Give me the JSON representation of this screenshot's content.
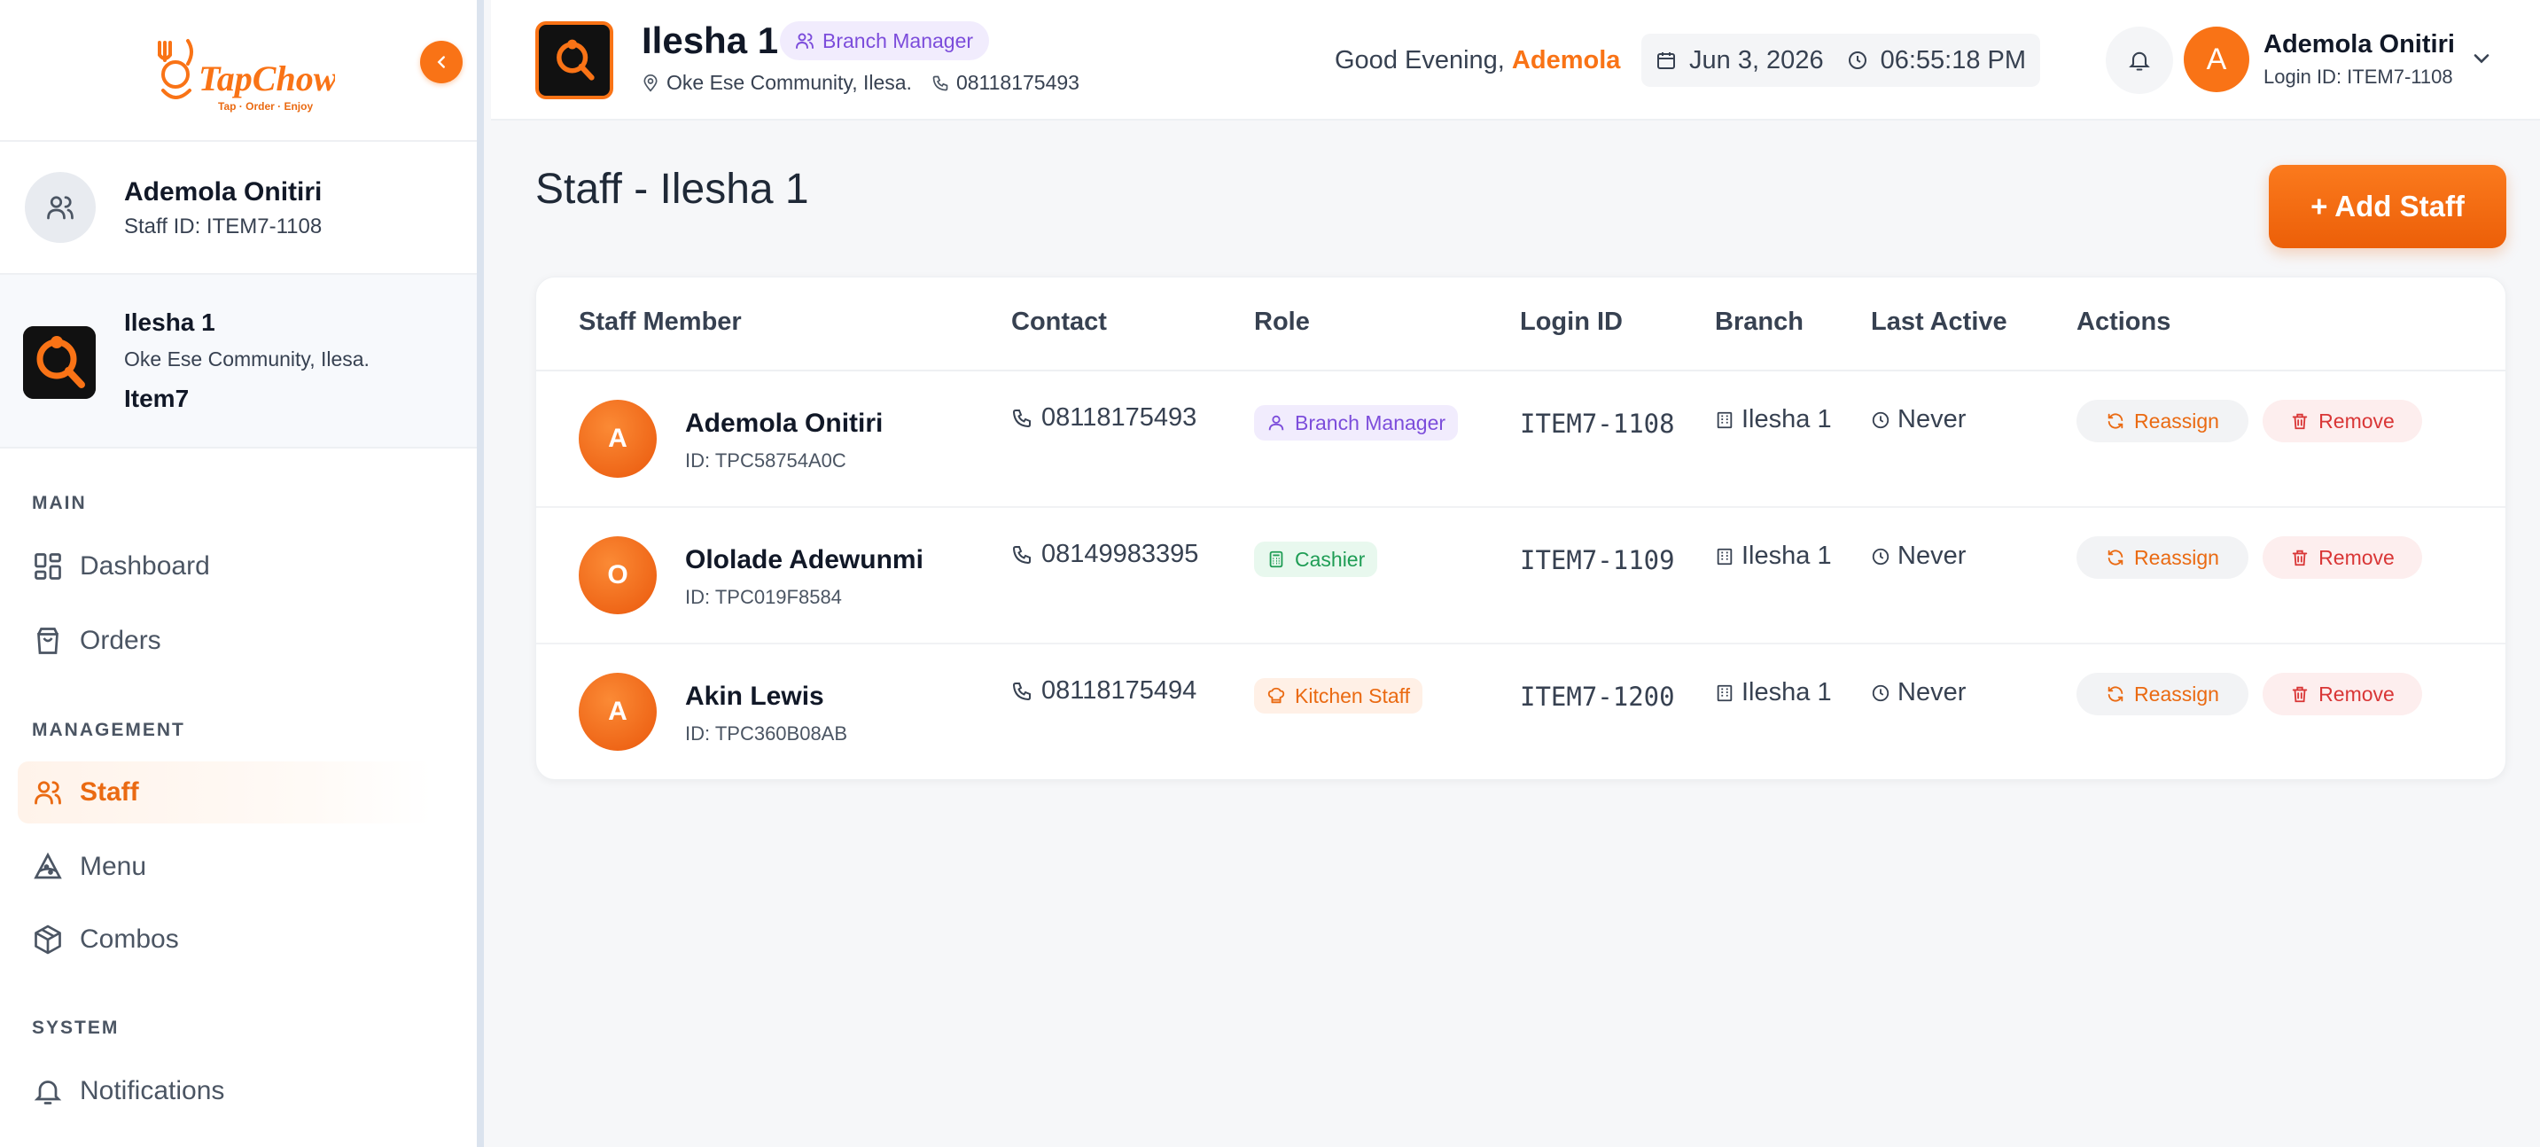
{
  "brand": {
    "logo_text": "TapChow",
    "tagline": "Tap · Order · Enjoy",
    "accent": "#f97316"
  },
  "sidebar": {
    "user": {
      "name": "Ademola Onitiri",
      "staff_id": "Staff ID: ITEM7-1108"
    },
    "branch": {
      "name": "Ilesha 1",
      "address": "Oke Ese Community, Ilesa.",
      "code": "Item7"
    },
    "sections": [
      {
        "title": "MAIN",
        "items": [
          {
            "label": "Dashboard",
            "icon": "grid-icon"
          },
          {
            "label": "Orders",
            "icon": "bag-icon"
          }
        ]
      },
      {
        "title": "MANAGEMENT",
        "items": [
          {
            "label": "Staff",
            "icon": "users-icon",
            "active": true
          },
          {
            "label": "Menu",
            "icon": "pizza-icon"
          },
          {
            "label": "Combos",
            "icon": "box-icon"
          }
        ]
      },
      {
        "title": "SYSTEM",
        "items": [
          {
            "label": "Notifications",
            "icon": "bell-icon"
          }
        ]
      }
    ]
  },
  "header": {
    "branch_name": "Ilesha 1",
    "role_badge": "Branch Manager",
    "address": "Oke Ese Community, Ilesa.",
    "phone": "08118175493",
    "greeting_prefix": "Good Evening,",
    "greeting_name": "Ademola",
    "date": "Jun 3, 2026",
    "time": "06:55:18 PM",
    "user_initial": "A",
    "user_name": "Ademola Onitiri",
    "login_id": "Login ID: ITEM7-1108"
  },
  "main": {
    "title": "Staff - Ilesha 1",
    "add_button": "+ Add Staff",
    "columns": [
      "Staff Member",
      "Contact",
      "Role",
      "Login ID",
      "Branch",
      "Last Active",
      "Actions"
    ],
    "rows": [
      {
        "initial": "A",
        "name": "Ademola Onitiri",
        "id": "ID: TPC58754A0C",
        "phone": "08118175493",
        "role": "Branch Manager",
        "role_type": "manager",
        "login_id": "ITEM7-1108",
        "branch": "Ilesha 1",
        "last_active": "Never",
        "reassign": "Reassign",
        "remove": "Remove"
      },
      {
        "initial": "O",
        "name": "Ololade Adewunmi",
        "id": "ID: TPC019F8584",
        "phone": "08149983395",
        "role": "Cashier",
        "role_type": "cashier",
        "login_id": "ITEM7-1109",
        "branch": "Ilesha 1",
        "last_active": "Never",
        "reassign": "Reassign",
        "remove": "Remove"
      },
      {
        "initial": "A",
        "name": "Akin Lewis",
        "id": "ID: TPC360B08AB",
        "phone": "08118175494",
        "role": "Kitchen Staff",
        "role_type": "kitchen",
        "login_id": "ITEM7-1200",
        "branch": "Ilesha 1",
        "last_active": "Never",
        "reassign": "Reassign",
        "remove": "Remove"
      }
    ]
  }
}
